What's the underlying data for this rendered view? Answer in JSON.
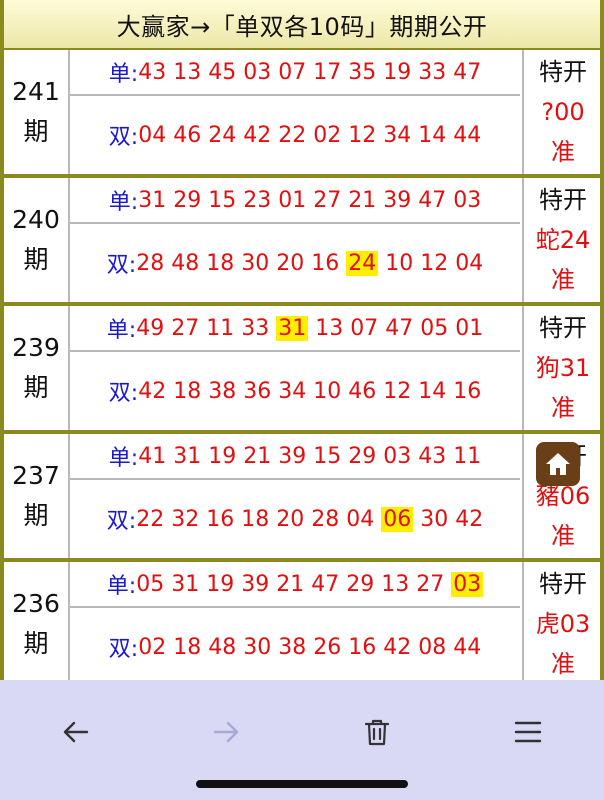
{
  "header": {
    "title": "大赢家→「单双各10码」期期公开"
  },
  "rows": [
    {
      "period_num": "241",
      "period_suffix": "期",
      "odd_label": "单:",
      "even_label": "双:",
      "odd": [
        "43",
        "13",
        "45",
        "03",
        "07",
        "17",
        "35",
        "19",
        "33",
        "47"
      ],
      "even": [
        "04",
        "46",
        "24",
        "42",
        "22",
        "02",
        "12",
        "34",
        "14",
        "44"
      ],
      "odd_highlight": -1,
      "even_highlight": -1,
      "special_title": "特开",
      "special_value": "?00",
      "special_status": "准"
    },
    {
      "period_num": "240",
      "period_suffix": "期",
      "odd_label": "单:",
      "even_label": "双:",
      "odd": [
        "31",
        "29",
        "15",
        "23",
        "01",
        "27",
        "21",
        "39",
        "47",
        "03"
      ],
      "even": [
        "28",
        "48",
        "18",
        "30",
        "20",
        "16",
        "24",
        "10",
        "12",
        "04"
      ],
      "odd_highlight": -1,
      "even_highlight": 6,
      "special_title": "特开",
      "special_value": "蛇24",
      "special_status": "准"
    },
    {
      "period_num": "239",
      "period_suffix": "期",
      "odd_label": "单:",
      "even_label": "双:",
      "odd": [
        "49",
        "27",
        "11",
        "33",
        "31",
        "13",
        "07",
        "47",
        "05",
        "01"
      ],
      "even": [
        "42",
        "18",
        "38",
        "36",
        "34",
        "10",
        "46",
        "12",
        "14",
        "16"
      ],
      "odd_highlight": 4,
      "even_highlight": -1,
      "special_title": "特开",
      "special_value": "狗31",
      "special_status": "准"
    },
    {
      "period_num": "237",
      "period_suffix": "期",
      "odd_label": "单:",
      "even_label": "双:",
      "odd": [
        "41",
        "31",
        "19",
        "21",
        "39",
        "15",
        "29",
        "03",
        "43",
        "11"
      ],
      "even": [
        "22",
        "32",
        "16",
        "18",
        "20",
        "28",
        "04",
        "06",
        "30",
        "42"
      ],
      "odd_highlight": -1,
      "even_highlight": 7,
      "special_title": "特开",
      "special_value": "豬06",
      "special_status": "准"
    },
    {
      "period_num": "236",
      "period_suffix": "期",
      "odd_label": "单:",
      "even_label": "双:",
      "odd": [
        "05",
        "31",
        "19",
        "39",
        "21",
        "47",
        "29",
        "13",
        "27",
        "03"
      ],
      "even": [
        "02",
        "18",
        "48",
        "30",
        "38",
        "26",
        "16",
        "42",
        "08",
        "44"
      ],
      "odd_highlight": 9,
      "even_highlight": -1,
      "special_title": "特开",
      "special_value": "虎03",
      "special_status": "准"
    }
  ],
  "floating": {
    "home_icon": "home-icon"
  },
  "toolbar": {
    "back_icon": "back-arrow-icon",
    "forward_icon": "forward-arrow-icon",
    "trash_icon": "trash-icon",
    "menu_icon": "menu-icon"
  },
  "colors": {
    "frame": "#8a8a1e",
    "number_red": "#e01010",
    "label_blue": "#1a1acc",
    "highlight": "#ffee00",
    "toolbar_bg": "#d9d8f5",
    "home_button": "#6a3e16"
  }
}
